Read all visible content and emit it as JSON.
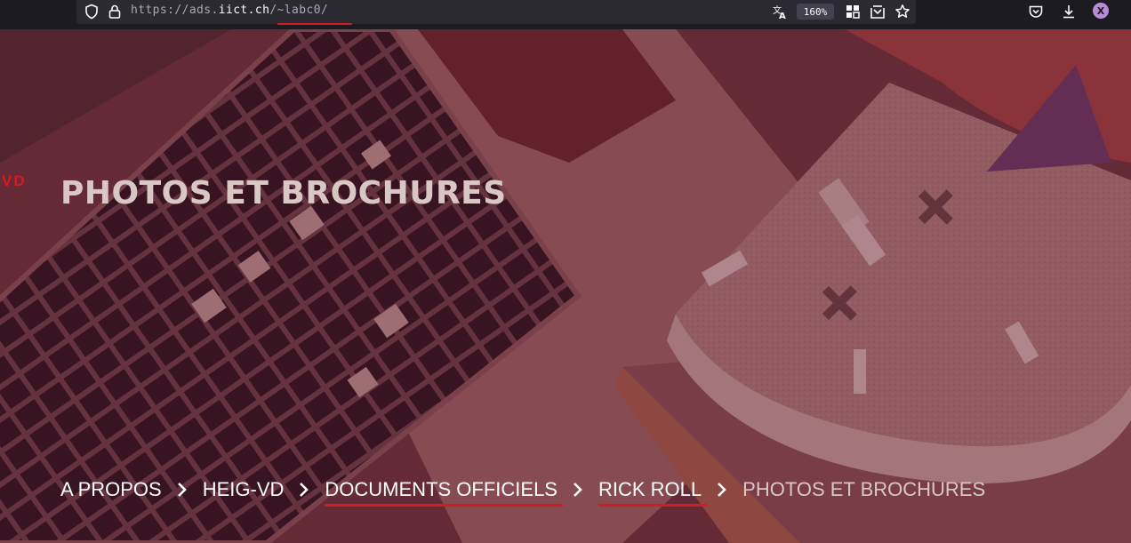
{
  "browser": {
    "url_prefix": "https://ads.",
    "url_host": "iict.ch",
    "url_path": "/~labc0/",
    "zoom": "160%",
    "profile_initial": "X",
    "accent_color": "#d71920"
  },
  "page": {
    "side_fragment": "VD",
    "title": "PHOTOS ET BROCHURES"
  },
  "breadcrumb": {
    "items": [
      {
        "label": "A PROPOS"
      },
      {
        "label": "HEIG-VD"
      },
      {
        "label": "DOCUMENTS OFFICIELS"
      },
      {
        "label": "RICK ROLL"
      },
      {
        "label": "PHOTOS ET BROCHURES"
      }
    ]
  },
  "icons": {
    "shield": "shield-icon",
    "lock": "lock-icon",
    "translate": "translate-icon",
    "extensions": "grid-icon",
    "screenshot": "screenshot-icon",
    "bookmark": "star-icon",
    "pocket": "pocket-icon",
    "download": "download-icon",
    "separator": "chevron-right-icon"
  }
}
